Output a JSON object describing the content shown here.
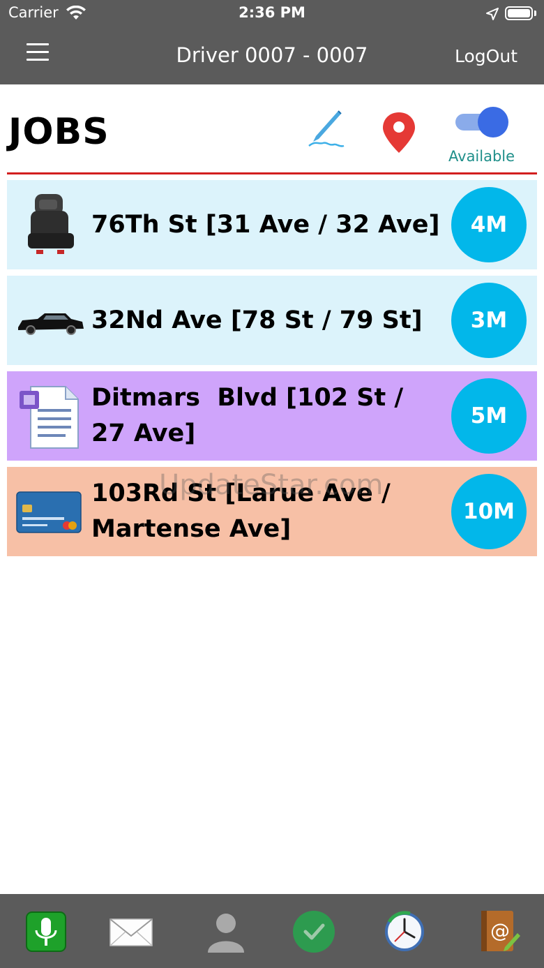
{
  "status_bar": {
    "carrier": "Carrier",
    "time": "2:36 PM"
  },
  "nav": {
    "title": "Driver 0007 - 0007",
    "logout_label": "LogOut"
  },
  "header": {
    "title": "JOBS",
    "available_label": "Available",
    "available_on": true
  },
  "jobs": [
    {
      "address": "76Th St [31 Ave / 32 Ave]",
      "eta": "4M",
      "bg": "#dcf3fb",
      "icon": "car-seat-icon"
    },
    {
      "address": "32Nd Ave [78 St / 79 St]",
      "eta": "3M",
      "bg": "#dcf3fb",
      "icon": "limousine-icon"
    },
    {
      "address": "Ditmars  Blvd [102 St /\n27 Ave]",
      "eta": "5M",
      "bg": "#cfa4fb",
      "icon": "document-icon"
    },
    {
      "address": "103Rd St [Larue Ave /\nMartense Ave]",
      "eta": "10M",
      "bg": "#f7c0a6",
      "icon": "credit-card-icon"
    }
  ],
  "watermark": "UpdateStar.com",
  "colors": {
    "bar": "#5b5b5b",
    "accent_red": "#d21f1f",
    "badge": "#02b7ea",
    "toggle": "#3a6be4"
  },
  "bottom_tabs": [
    "microphone-icon",
    "mail-icon",
    "user-icon",
    "check-icon",
    "clock-refresh-icon",
    "address-book-icon"
  ]
}
